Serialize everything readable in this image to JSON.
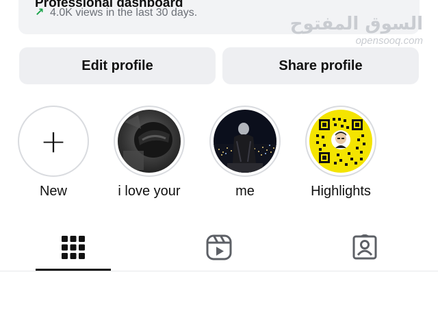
{
  "dashboard": {
    "title": "Professional dashboard",
    "views_text": "4.0K views in the last 30 days.",
    "arrow": "↗"
  },
  "watermark": {
    "arabic": "السوق المفتوح",
    "english": "opensooq.com"
  },
  "buttons": {
    "edit_label": "Edit profile",
    "share_label": "Share profile"
  },
  "highlights": [
    {
      "label": "New",
      "icon": "plus-icon"
    },
    {
      "label": "i love your",
      "icon": "helmet-photo"
    },
    {
      "label": "me",
      "icon": "night-city-photo"
    },
    {
      "label": "Highlights",
      "icon": "qr-code-photo"
    }
  ],
  "tabs": [
    {
      "name": "grid",
      "icon": "grid-icon",
      "active": true
    },
    {
      "name": "reels",
      "icon": "reels-icon",
      "active": false
    },
    {
      "name": "tagged",
      "icon": "tagged-person-icon",
      "active": false
    }
  ],
  "colors": {
    "accent_arrow": "#1aa34a",
    "button_bg": "#eeeff2",
    "qr_yellow": "#f4e400"
  }
}
